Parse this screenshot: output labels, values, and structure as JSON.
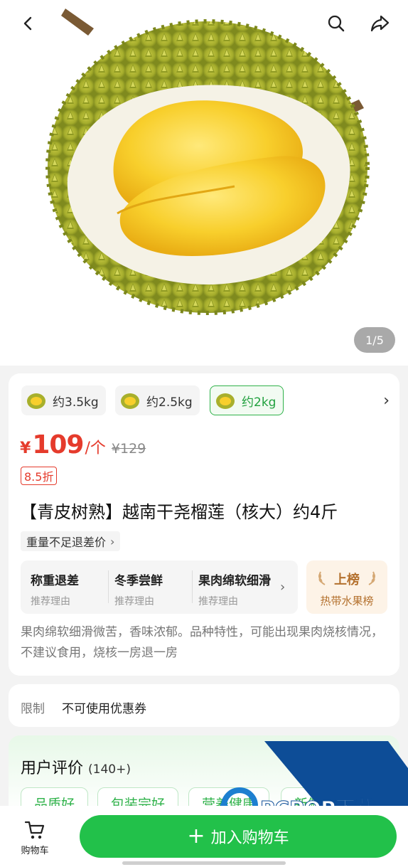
{
  "header": {
    "image_counter": "1/5"
  },
  "specs": {
    "items": [
      {
        "label": "约3.5kg",
        "selected": false
      },
      {
        "label": "约2.5kg",
        "selected": false
      },
      {
        "label": "约2kg",
        "selected": true
      }
    ]
  },
  "price": {
    "currency": "¥",
    "value": "109",
    "unit": "/个",
    "original": "¥129",
    "discount": "8.5折"
  },
  "product": {
    "title": "【青皮树熟】越南干尧榴莲（核大）约4斤",
    "refund_tag": "重量不足退差价",
    "description": "果肉绵软细滑微苦，香味浓郁。品种特性，可能出现果肉烧核情况，不建议食用，烧核一房退一房"
  },
  "reasons": {
    "items": [
      {
        "title": "称重退差",
        "subtitle": "推荐理由"
      },
      {
        "title": "冬季尝鲜",
        "subtitle": "推荐理由"
      },
      {
        "title": "果肉绵软细滑",
        "subtitle": "推荐理由"
      }
    ]
  },
  "rank": {
    "title": "上榜",
    "subtitle": "热带水果榜"
  },
  "restriction": {
    "label": "限制",
    "value": "不可使用优惠券"
  },
  "reviews": {
    "title": "用户评价",
    "count": "(140+)",
    "tags": [
      "品质好",
      "包装完好",
      "营养健康",
      "新鲜"
    ]
  },
  "watermark": {
    "brand": "PCPOP下载",
    "sub": "PCPOP Download"
  },
  "bottom_bar": {
    "cart_label": "购物车",
    "add_to_cart": "加入购物车"
  },
  "colors": {
    "accent_green": "#22c14a",
    "price_red": "#e53b2c",
    "rank_brown": "#b4712e"
  }
}
